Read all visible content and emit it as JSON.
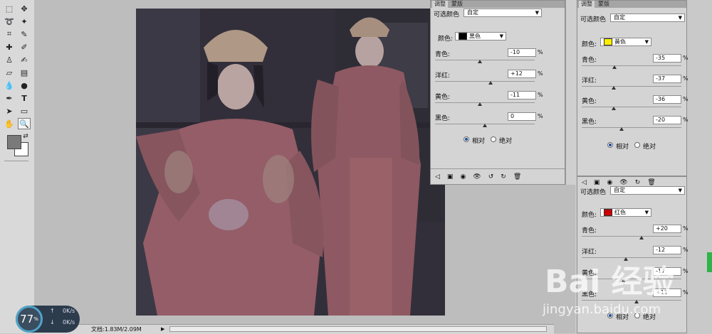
{
  "statusbar": {
    "zoom": "33.88%",
    "doc_info": "文档:1.83M/2.09M"
  },
  "widget": {
    "percent": "77",
    "unit": "%",
    "upload": "0K/s",
    "download": "0K/s"
  },
  "panels": [
    {
      "id": "black",
      "tabs": [
        "调整",
        "蒙版"
      ],
      "preset_label": "可选颜色",
      "preset_value": "自定",
      "color_label": "颜色:",
      "color_name": "黑色",
      "swatch": "#000000",
      "sliders": [
        {
          "label": "青色:",
          "value": "-10",
          "pct": "%",
          "fraction": 0.45
        },
        {
          "label": "洋红:",
          "value": "+12",
          "pct": "%",
          "fraction": 0.56
        },
        {
          "label": "黄色:",
          "value": "-11",
          "pct": "%",
          "fraction": 0.45
        },
        {
          "label": "黑色:",
          "value": "0",
          "pct": "%",
          "fraction": 0.5
        }
      ],
      "mode_relative": "相对",
      "mode_absolute": "绝对"
    },
    {
      "id": "yellow",
      "tabs": [
        "调整",
        "蒙版"
      ],
      "preset_label": "可选颜色",
      "preset_value": "自定",
      "color_label": "颜色:",
      "color_name": "黄色",
      "swatch": "#ffee00",
      "sliders": [
        {
          "label": "青色:",
          "value": "-35",
          "pct": "%",
          "fraction": 0.33
        },
        {
          "label": "洋红:",
          "value": "-37",
          "pct": "%",
          "fraction": 0.32
        },
        {
          "label": "黄色:",
          "value": "-36",
          "pct": "%",
          "fraction": 0.32
        },
        {
          "label": "黑色:",
          "value": "-20",
          "pct": "%",
          "fraction": 0.4
        }
      ],
      "mode_relative": "相对",
      "mode_absolute": "绝对"
    },
    {
      "id": "red",
      "tabs": [],
      "preset_label": "可选颜色",
      "preset_value": "自定",
      "color_label": "颜色:",
      "color_name": "红色",
      "swatch": "#cc0000",
      "sliders": [
        {
          "label": "青色:",
          "value": "+20",
          "pct": "%",
          "fraction": 0.6
        },
        {
          "label": "洋红:",
          "value": "-12",
          "pct": "%",
          "fraction": 0.44
        },
        {
          "label": "黄色:",
          "value": "-17",
          "pct": "%",
          "fraction": 0.42
        },
        {
          "label": "黑色:",
          "value": "+11",
          "pct": "%",
          "fraction": 0.55
        }
      ],
      "mode_relative": "相对",
      "mode_absolute": "绝对"
    }
  ],
  "watermark": {
    "brand": "Bai 经验",
    "url": "jingyan.baidu.com"
  },
  "colors": {
    "radio_on": "#1a4a9a",
    "panel_bg": "#d4d4d4",
    "canvas_bg": "#bdbdbd"
  }
}
